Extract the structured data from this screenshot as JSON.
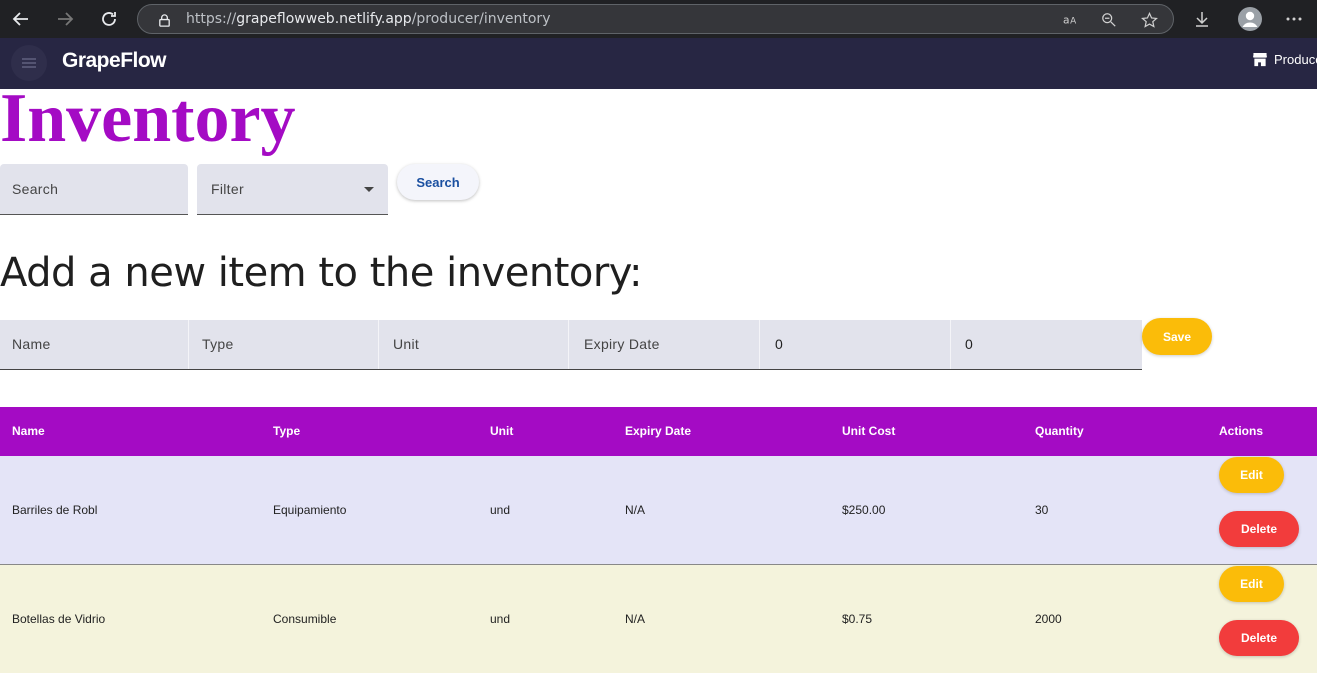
{
  "browser": {
    "url_prefix": "https://",
    "url_host": "grapeflowweb.netlify.app",
    "url_path": "/producer/inventory"
  },
  "app": {
    "brand": "GrapeFlow",
    "producer_link": "Produce"
  },
  "page": {
    "title": "Inventory"
  },
  "search": {
    "search_placeholder": "Search",
    "filter_placeholder": "Filter",
    "search_button": "Search"
  },
  "add_item": {
    "heading": "Add a new item to the inventory:",
    "name_placeholder": "Name",
    "type_placeholder": "Type",
    "unit_placeholder": "Unit",
    "expiry_placeholder": "Expiry Date",
    "unit_cost_value": "0",
    "quantity_value": "0",
    "save_button": "Save"
  },
  "table": {
    "headers": [
      "Name",
      "Type",
      "Unit",
      "Expiry Date",
      "Unit Cost",
      "Quantity",
      "Actions"
    ],
    "rows": [
      {
        "name": "Barriles de Robl",
        "type": "Equipamiento",
        "unit": "und",
        "expiry": "N/A",
        "unit_cost": "$250.00",
        "quantity": "30",
        "edit": "Edit",
        "delete": "Delete"
      },
      {
        "name": "Botellas de Vidrio",
        "type": "Consumible",
        "unit": "und",
        "expiry": "N/A",
        "unit_cost": "$0.75",
        "quantity": "2000",
        "edit": "Edit",
        "delete": "Delete"
      }
    ],
    "row_colors": [
      "#e4e4f7",
      "#f4f3dc"
    ]
  },
  "colors": {
    "accent": "#a40bc4",
    "app_bar": "#272643",
    "save": "#fbbc09",
    "delete": "#f23c3c"
  }
}
